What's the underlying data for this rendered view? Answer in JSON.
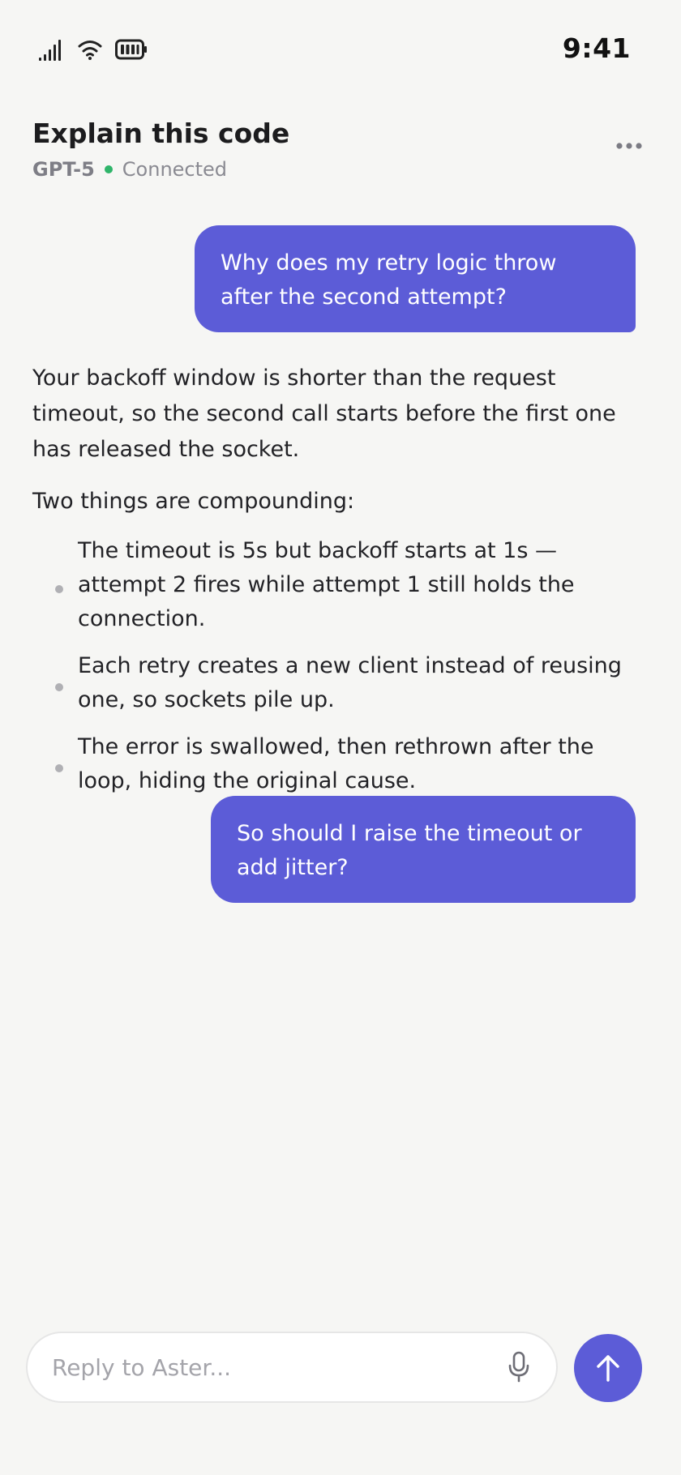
{
  "status_bar": {
    "time": "9:41",
    "icons": [
      "signal-icon",
      "wifi-icon",
      "battery-icon"
    ]
  },
  "header": {
    "title": "Explain this code",
    "model": "GPT-5",
    "status": "Connected",
    "status_color": "#2fb56a",
    "menu_icon": "more-horizontal-icon"
  },
  "colors": {
    "accent": "#5c5cd7",
    "background": "#f6f6f4",
    "text": "#1c1c1e",
    "muted": "#8a8a92"
  },
  "messages": [
    {
      "role": "user",
      "text": "Why does my retry logic throw after the second attempt?"
    },
    {
      "role": "assistant",
      "intro": "Your backoff window is shorter than the request timeout, so the second call starts before the first one has released the socket.",
      "lead": "Two things are compounding:",
      "bullets": [
        "The timeout is 5s but backoff starts at 1s — attempt 2 fires while attempt 1 still holds the connection.",
        "Each retry creates a new client instead of reusing one, so sockets pile up.",
        "The error is swallowed, then rethrown after the loop, hiding the original cause."
      ]
    },
    {
      "role": "user",
      "text": "So should I raise the timeout or add jitter?"
    }
  ],
  "composer": {
    "placeholder": "Reply to Aster...",
    "value": "",
    "mic_icon": "microphone-icon",
    "send_icon": "arrow-up-icon"
  }
}
